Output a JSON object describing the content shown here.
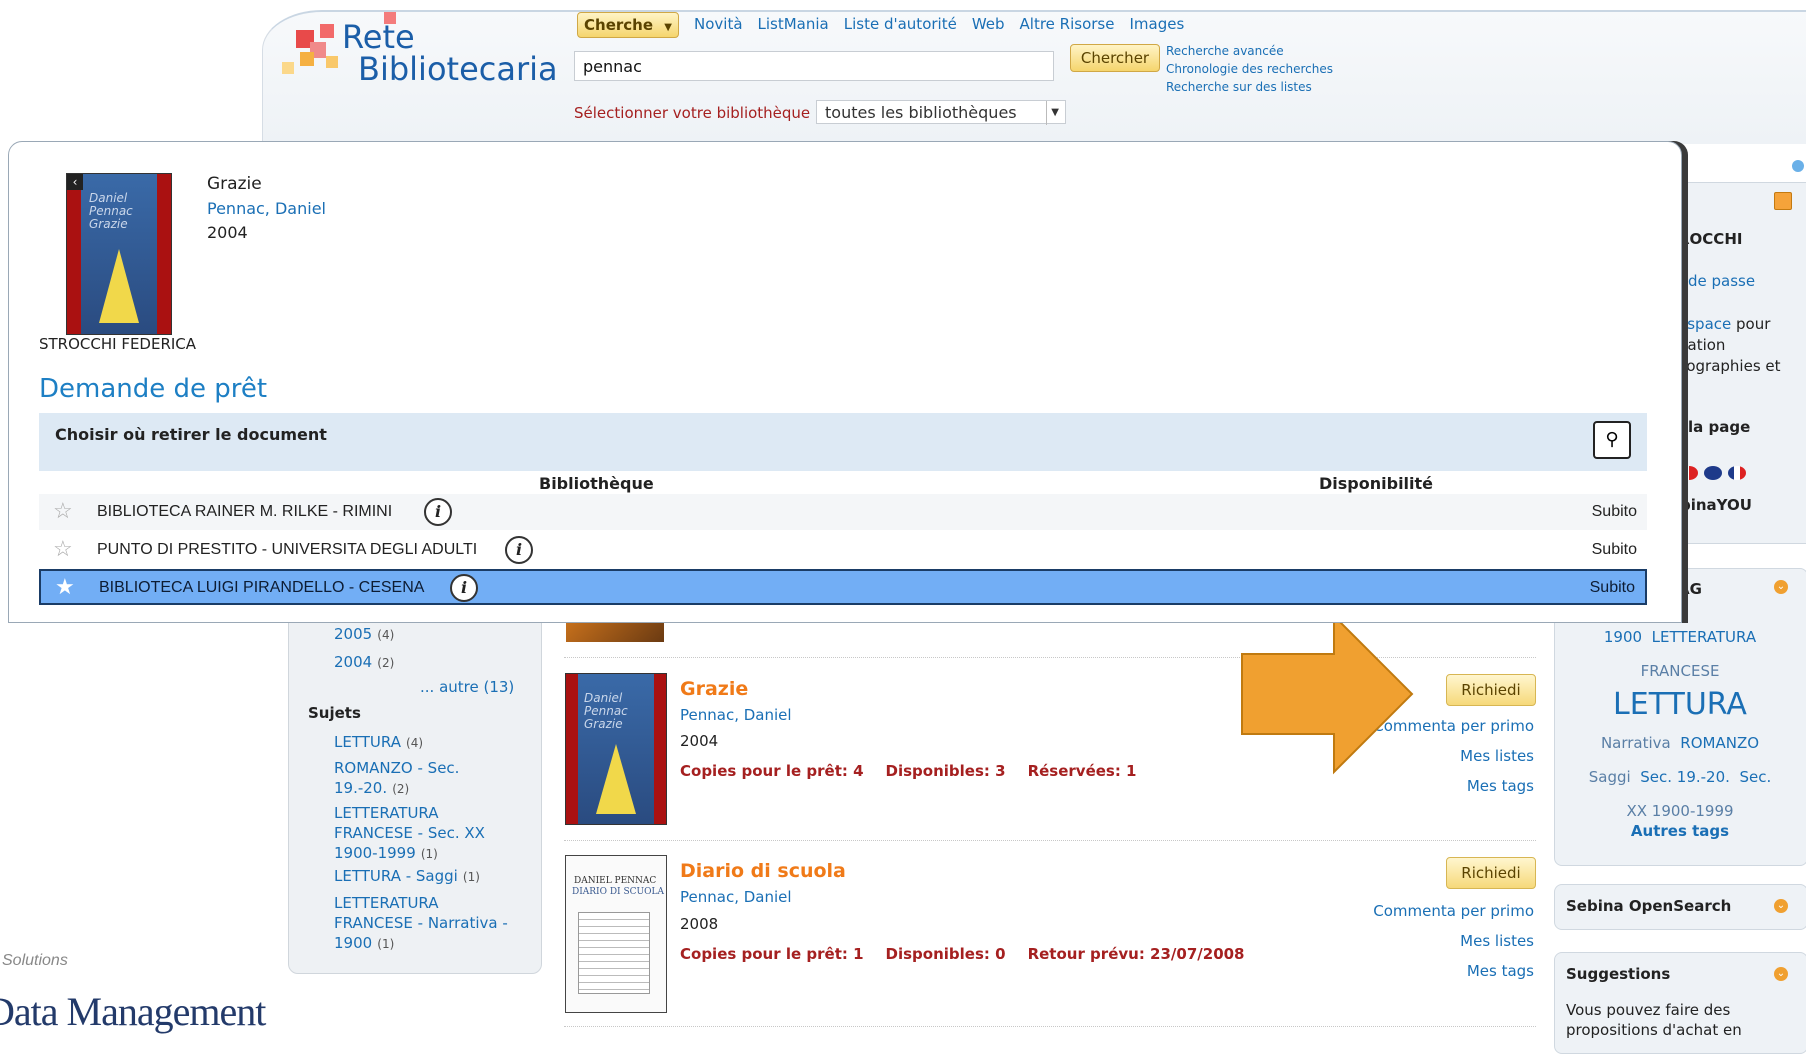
{
  "header": {
    "logo_line1": "Rete",
    "logo_line2": "Bibliotecaria",
    "search_type": "Cherche",
    "nav": [
      "Novità",
      "ListMania",
      "Liste d'autorité",
      "Web",
      "Altre Risorse",
      "Images"
    ],
    "search_value": "pennac",
    "search_button": "Chercher",
    "links": [
      "Recherche avancée",
      "Chronologie des recherches",
      "Recherche sur des listes"
    ],
    "library_label": "Sélectionner votre bibliothèque",
    "library_value": "toutes les bibliothèques"
  },
  "popup": {
    "book_title": "Grazie",
    "book_author": "Pennac, Daniel",
    "book_year": "2004",
    "cover_line1": "Daniel",
    "cover_line2": "Pennac",
    "cover_line3": "Grazie",
    "user_name": "STROCCHI FEDERICA",
    "heading": "Demande de prêt",
    "choose_label": "Choisir où retirer le document",
    "col_library": "Bibliothèque",
    "col_availability": "Disponibilité",
    "libraries": [
      {
        "name": "BIBLIOTECA RAINER M. RILKE - RIMINI",
        "availability": "Subito"
      },
      {
        "name": "PUNTO DI PRESTITO - UNIVERSITA DEGLI ADULTI",
        "availability": "Subito"
      },
      {
        "name": "BIBLIOTECA LUIGI PIRANDELLO - CESENA",
        "availability": "Subito"
      }
    ]
  },
  "sidebar": {
    "user_title": "ROCCHI",
    "password_link": "de passe",
    "space_link": "espace",
    "space_text1": "pour",
    "space_text2": "uation",
    "space_text3": "liographies et",
    "page_text": "la page",
    "binayou": "binaYOU",
    "tag_title": "AG",
    "tags": [
      "1900",
      "LETTERATURA",
      "FRANCESE",
      "LETTURA",
      "Narrativa",
      "ROMANZO",
      "Saggi",
      "Sec. 19.-20.",
      "Sec.",
      "XX",
      "1900-1999"
    ],
    "more_tags": "Autres tags",
    "opensearch": "Sebina OpenSearch",
    "suggestions_title": "Suggestions",
    "suggestions_text1": "Vous pouvez faire des",
    "suggestions_text2": "propositions d'achat en"
  },
  "facets": {
    "years": [
      {
        "label": "2005",
        "count": "(4)"
      },
      {
        "label": "2004",
        "count": "(2)"
      }
    ],
    "more": "... autre (13)",
    "subjects_title": "Sujets",
    "subjects": [
      {
        "label": "LETTURA",
        "count": "(4)"
      },
      {
        "label": "ROMANZO - Sec. 19.-20.",
        "count": "(2)"
      },
      {
        "label": "LETTERATURA FRANCESE - Sec. XX 1900-1999",
        "count": "(1)"
      },
      {
        "label": "LETTURA - Saggi",
        "count": "(1)"
      },
      {
        "label": "LETTERATURA FRANCESE - Narrativa - 1900",
        "count": "(1)"
      }
    ]
  },
  "results": [
    {
      "title": "Grazie",
      "author": "Pennac, Daniel",
      "year": "2004",
      "copies": "Copies pour le prêt: 4",
      "available": "Disponibles: 3",
      "reserved": "Réservées: 1",
      "button": "Richiedi",
      "comment": "Commenta per primo",
      "lists": "Mes listes",
      "tags": "Mes tags"
    },
    {
      "title": "Diario di scuola",
      "author": "Pennac, Daniel",
      "year": "2008",
      "copies": "Copies pour le prêt: 1",
      "available": "Disponibles: 0",
      "reserved": "Retour prévu: 23/07/2008",
      "button": "Richiedi",
      "comment": "Commenta per primo",
      "lists": "Mes listes",
      "tags": "Mes tags",
      "cover_line1": "DANIEL PENNAC",
      "cover_line2": "DIARIO DI SCUOLA"
    }
  ],
  "branding": {
    "solutions": "Solutions",
    "data_management": "Data Management"
  },
  "colors": {
    "accent_orange": "#f07a18",
    "link_blue": "#1a6fb5",
    "selected_row": "#72aef5",
    "arrow": "#f0a030"
  }
}
